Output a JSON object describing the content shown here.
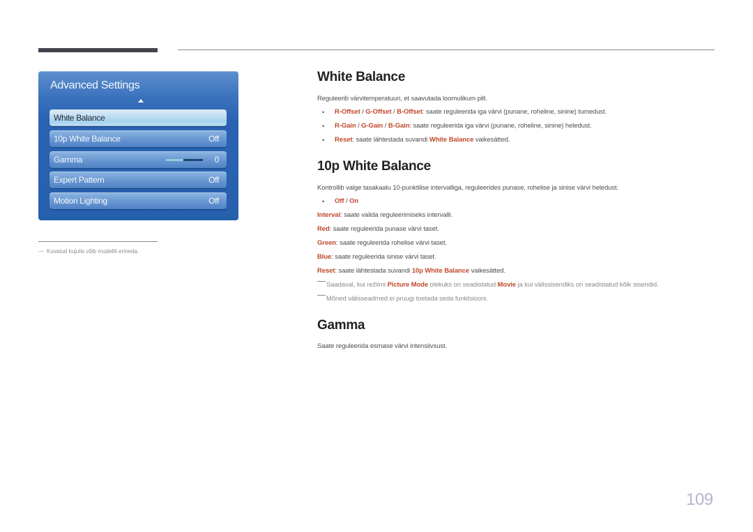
{
  "panel": {
    "title": "Advanced Settings",
    "items": [
      {
        "label": "White Balance",
        "value": "",
        "selected": true
      },
      {
        "label": "10p White Balance",
        "value": "Off"
      },
      {
        "label": "Gamma",
        "value": "0",
        "slider_level": 0.5
      },
      {
        "label": "Expert Pattern",
        "value": "Off"
      },
      {
        "label": "Motion Lighting",
        "value": "Off"
      }
    ]
  },
  "side_note": {
    "dash": "―",
    "text": "Kuvatud kujutis võib mudeliti erineda."
  },
  "sections": {
    "white_balance": {
      "title": "White Balance",
      "intro": "Reguleerib värvitemperatuuri, et saavutada loomulikum pilt.",
      "bullets": [
        {
          "parts": [
            "R-Offset",
            " / ",
            "G-Offset",
            " / ",
            "B-Offset",
            ": saate reguleerida iga värvi (punane, roheline, sinine) tumedust."
          ]
        },
        {
          "parts": [
            "R-Gain",
            " / ",
            "G-Gain",
            " / ",
            "B-Gain",
            ": saate reguleerida iga värvi (punane, roheline, sinine) heledust."
          ]
        },
        {
          "parts": [
            "Reset",
            ": saate lähtestada suvandi ",
            "White Balance",
            " vaikesätted."
          ]
        }
      ]
    },
    "tenp_white_balance": {
      "title": "10p White Balance",
      "intro": "Kontrollib valge tasakaalu 10-punktilise intervalliga, reguleerides punase, rohelise ja sinise värvi heledust.",
      "option": {
        "off": "Off",
        "sep": " / ",
        "on": "On"
      },
      "lines": [
        {
          "key": "Interval",
          "text": ": saate valida reguleerimiseks intervalli."
        },
        {
          "key": "Red",
          "text": ": saate reguleerida punase värvi taset."
        },
        {
          "key": "Green",
          "text": ": saate reguleerida rohelise värvi taset."
        },
        {
          "key": "Blue",
          "text": ": saate reguleerida sinise värvi taset."
        },
        {
          "key": "Reset",
          "text": ": saate lähtestada suvandi ",
          "key2": "10p White Balance",
          "text2": " vaikesätted."
        }
      ],
      "notes": [
        {
          "a": "Saadaval, kui režiimi ",
          "b": "Picture Mode",
          "c": " olekuks on seadistatud ",
          "d": "Movie",
          "e": " ja kui välissisendiks on seadistatud kõik sisendid."
        },
        {
          "a": "Mõned välisseadmed ei pruugi toetada seda funktsiooni."
        }
      ]
    },
    "gamma": {
      "title": "Gamma",
      "intro": "Saate reguleerida esmase värvi intensiivsust."
    }
  },
  "page_number": "109",
  "colors": {
    "accent": "#c0482a",
    "panel_blue": "#2560ad",
    "page_number": "#b8b3cf"
  }
}
